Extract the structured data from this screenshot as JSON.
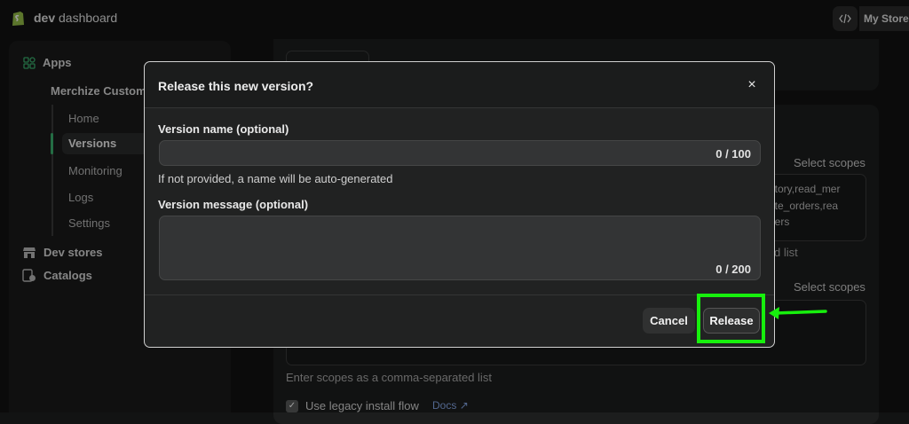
{
  "topbar": {
    "brand_bold": "dev",
    "brand_rest": " dashboard",
    "code_icon": "code-icon",
    "store_label": "My Store"
  },
  "sidebar": {
    "apps_label": "Apps",
    "app_name": "Merchize Custom",
    "sub_items": [
      "Home",
      "Versions",
      "Monitoring",
      "Logs",
      "Settings"
    ],
    "active_item": "Versions",
    "dev_stores_label": "Dev stores",
    "catalogs_label": "Catalogs"
  },
  "background": {
    "select_scopes_1": "Select scopes",
    "scope_text": "ntory,read_mer\nrite_orders,rea\nders",
    "partial_help": "d list",
    "select_scopes_2": "Select scopes",
    "help_text": "Enter scopes as a comma-separated list",
    "legacy_label": "Use legacy install flow",
    "docs_label": "Docs"
  },
  "dialog": {
    "title": "Release this new version?",
    "close_icon": "×",
    "version_name_label": "Version name (optional)",
    "version_name_value": "",
    "version_name_counter": "0 / 100",
    "version_name_hint": "If not provided, a name will be auto-generated",
    "version_message_label": "Version message (optional)",
    "version_message_value": "",
    "version_message_counter": "0 / 200",
    "cancel_label": "Cancel",
    "release_label": "Release"
  },
  "annotation": {
    "highlight_color": "#17f00d"
  }
}
